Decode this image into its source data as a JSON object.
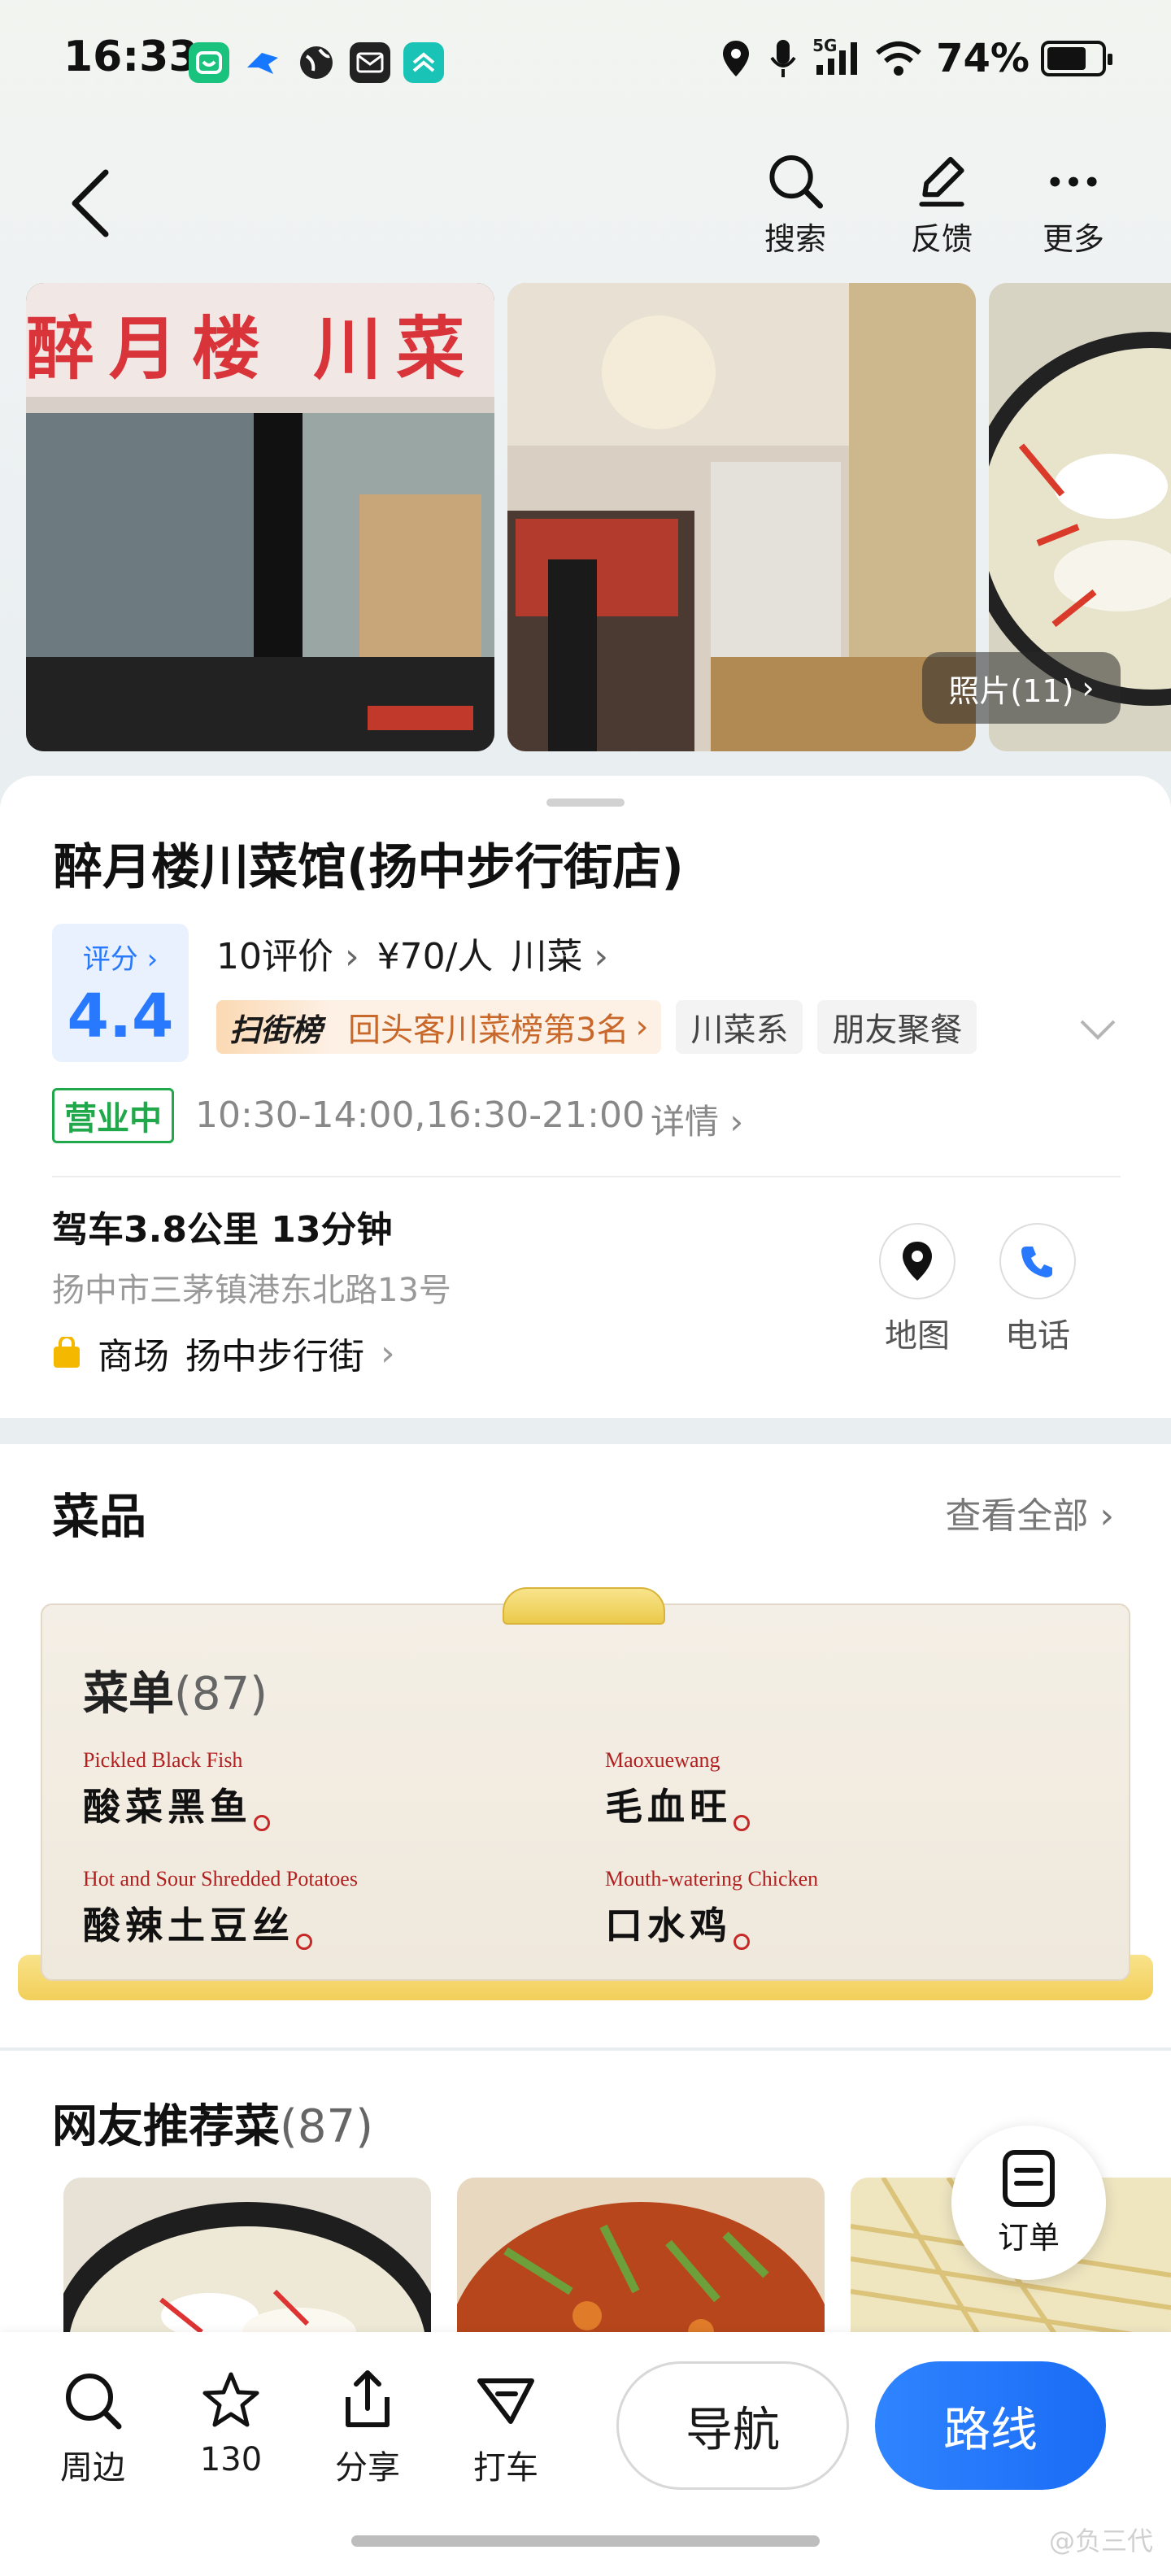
{
  "status_bar": {
    "time": "16:33",
    "network": "5G",
    "battery": "74%",
    "battery_level": 0.74
  },
  "top_nav": {
    "search_label": "搜索",
    "feedback_label": "反馈",
    "more_label": "更多"
  },
  "photos": {
    "count_label": "照片(11)",
    "storefront_sign": "醉月楼 川菜"
  },
  "poi": {
    "name": "醉月楼川菜馆(扬中步行街店)",
    "score_label": "评分",
    "score": "4.4",
    "reviews": "10评价",
    "price": "¥70/人",
    "category": "川菜",
    "rank_logo": "扫街榜",
    "rank_text": "回头客川菜榜第3名",
    "tags": [
      "川菜系",
      "朋友聚餐"
    ],
    "open_status": "营业中",
    "hours": "10:30-14:00,16:30-21:00",
    "hours_detail": "详情",
    "drive_info": "驾车3.8公里 13分钟",
    "address": "扬中市三茅镇港东北路13号",
    "mall_type": "商场",
    "mall_name": "扬中步行街",
    "map_label": "地图",
    "phone_label": "电话"
  },
  "dishes": {
    "title": "菜品",
    "view_all": "查看全部",
    "menu_title": "菜单",
    "menu_count": "(87)",
    "items": [
      {
        "en": "Pickled Black Fish",
        "cn": "酸菜黑鱼"
      },
      {
        "en": "Maoxuewang",
        "cn": "毛血旺"
      },
      {
        "en": "Hot and Sour Shredded Potatoes",
        "cn": "酸辣土豆丝"
      },
      {
        "en": "Mouth-watering Chicken",
        "cn": "口水鸡"
      }
    ]
  },
  "recommended": {
    "title": "网友推荐菜",
    "count": "(87)",
    "order_label": "订单"
  },
  "bottom_bar": {
    "nearby_label": "周边",
    "favorites_count": "130",
    "share_label": "分享",
    "taxi_label": "打车",
    "navigate_label": "导航",
    "route_label": "路线"
  },
  "watermark": "@负三代",
  "colors": {
    "accent_blue": "#2979ff",
    "open_green": "#21a84a",
    "rank_orange": "#c8692b",
    "menu_red": "#b22020"
  }
}
